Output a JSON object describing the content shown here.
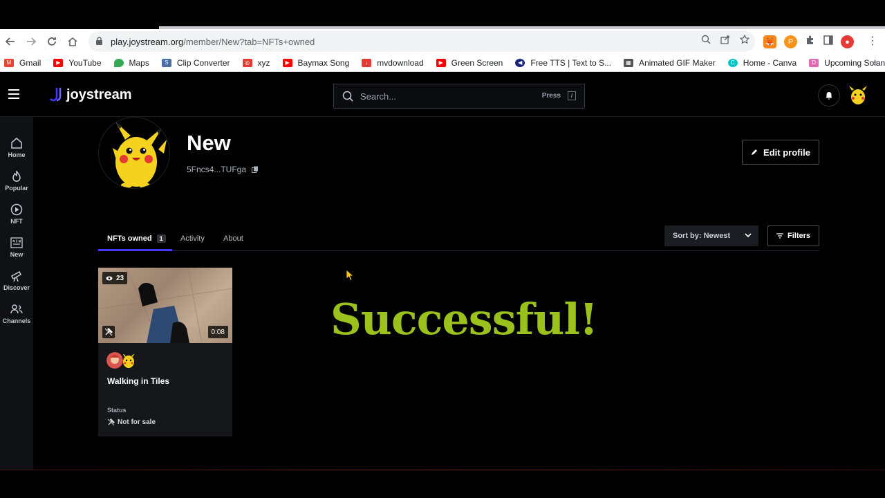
{
  "browser": {
    "url_host": "play.joystream.org",
    "url_path": "/member/New?tab=NFTs+owned",
    "bookmarks": [
      {
        "label": "Gmail",
        "color": "#ea4335"
      },
      {
        "label": "YouTube",
        "color": "#ff0000"
      },
      {
        "label": "Maps",
        "color": "#34a853"
      },
      {
        "label": "Clip Converter",
        "color": "#4a6fa5"
      },
      {
        "label": "xyz",
        "color": "#e53935"
      },
      {
        "label": "Baymax Song",
        "color": "#ff0000"
      },
      {
        "label": "mvdownload",
        "color": "#e53935"
      },
      {
        "label": "Green Screen",
        "color": "#ff0000"
      },
      {
        "label": "Free TTS | Text to S...",
        "color": "#1a237e"
      },
      {
        "label": "Animated GIF Maker",
        "color": "#555555"
      },
      {
        "label": "Home - Canva",
        "color": "#00c4cc"
      },
      {
        "label": "Upcoming Solana...",
        "color": "#e06bb3"
      }
    ],
    "more_glyph": "»"
  },
  "app": {
    "brand": "joystream",
    "search_placeholder": "Search...",
    "search_press": "Press",
    "search_key": "/",
    "sidebar": [
      {
        "label": "Home",
        "icon": "home-icon"
      },
      {
        "label": "Popular",
        "icon": "flame-icon"
      },
      {
        "label": "NFT",
        "icon": "play-circle-icon"
      },
      {
        "label": "New",
        "icon": "new-badge-icon"
      },
      {
        "label": "Discover",
        "icon": "telescope-icon"
      },
      {
        "label": "Channels",
        "icon": "users-icon"
      }
    ]
  },
  "profile": {
    "name": "New",
    "address": "5Fncs4...TUFga",
    "edit_label": "Edit profile"
  },
  "tabs": [
    {
      "label": "NFTs owned",
      "count": "1",
      "active": true
    },
    {
      "label": "Activity",
      "active": false
    },
    {
      "label": "About",
      "active": false
    }
  ],
  "sort": {
    "label": "Sort by: Newest"
  },
  "filters": {
    "label": "Filters"
  },
  "nft_card": {
    "views": "23",
    "duration": "0:08",
    "title": "Walking in Tiles",
    "status_label": "Status",
    "status_value": "Not for sale"
  },
  "overlay_text": "Successful!",
  "colors": {
    "accent": "#4038ff",
    "success": "#9bc21c",
    "pikachu": "#f5d21e"
  }
}
